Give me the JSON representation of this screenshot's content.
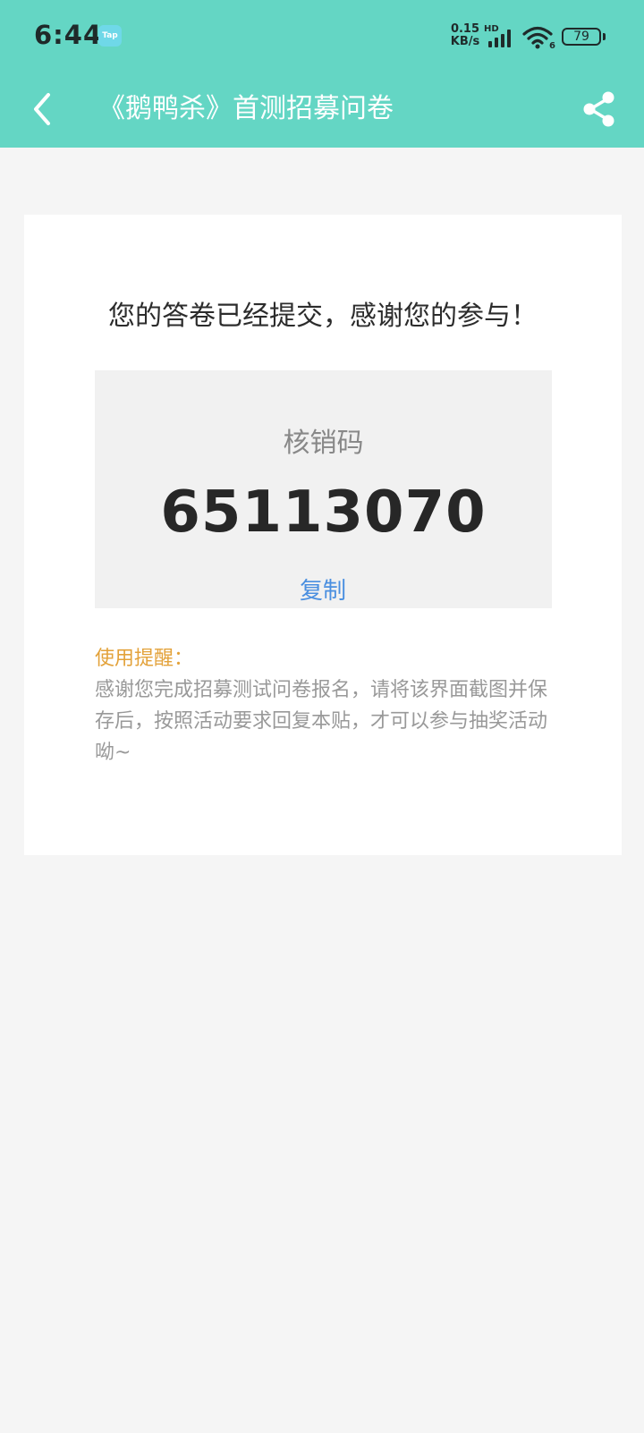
{
  "status_bar": {
    "time": "6:44",
    "app_icon_label": "Tap",
    "net_speed_value": "0.15",
    "net_speed_unit": "KB/s",
    "hd_label": "HD",
    "wifi_label": "6",
    "battery_level": "79"
  },
  "app_bar": {
    "title": "《鹅鸭杀》首测招募问卷",
    "back_icon": "chevron-left-icon",
    "share_icon": "share-icon"
  },
  "result": {
    "message": "您的答卷已经提交，感谢您的参与！",
    "code_label": "核销码",
    "code_value": "65113070",
    "copy_label": "复制"
  },
  "tips": {
    "title": "使用提醒：",
    "body": "感谢您完成招募测试问卷报名，请将该界面截图并保存后，按照活动要求回复本贴，才可以参与抽奖活动呦~"
  },
  "colors": {
    "accent": "#64d6c4",
    "link": "#4a8fe0",
    "tip_title": "#e3a23a"
  }
}
